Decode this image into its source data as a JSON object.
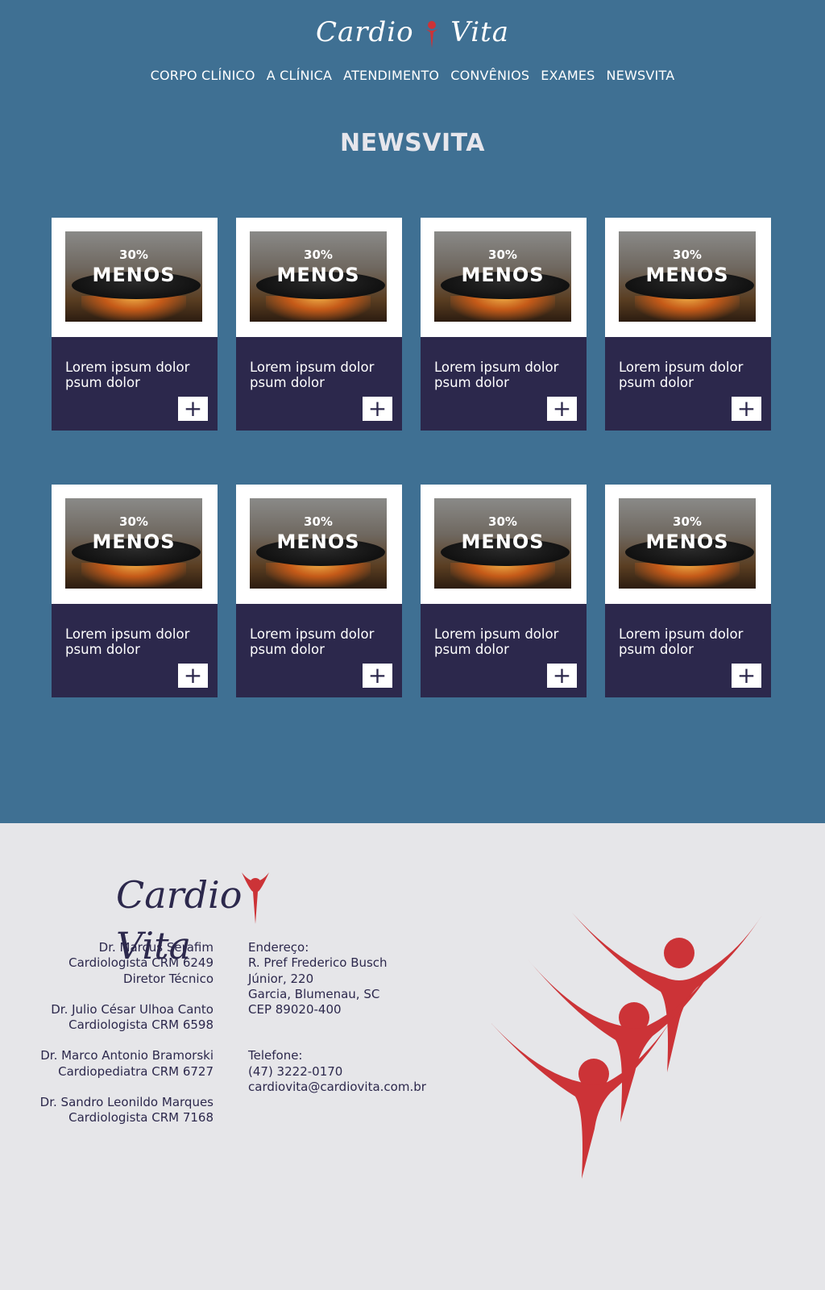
{
  "header": {
    "logo_text_left": "Cardio",
    "logo_text_right": "Vita",
    "nav": [
      "CORPO CLÍNICO",
      "A CLÍNICA",
      "ATENDIMENTO",
      "CONVÊNIOS",
      "EXAMES",
      "NEWSVITA"
    ]
  },
  "page_title": "NEWSVITA",
  "cards": [
    {
      "badge_pct": "30%",
      "badge_word": "MENOS",
      "text": "Lorem ipsum dolor psum dolor",
      "more_label": "+"
    },
    {
      "badge_pct": "30%",
      "badge_word": "MENOS",
      "text": "Lorem ipsum dolor psum dolor",
      "more_label": "+"
    },
    {
      "badge_pct": "30%",
      "badge_word": "MENOS",
      "text": "Lorem ipsum dolor psum dolor",
      "more_label": "+"
    },
    {
      "badge_pct": "30%",
      "badge_word": "MENOS",
      "text": "Lorem ipsum dolor psum dolor",
      "more_label": "+"
    },
    {
      "badge_pct": "30%",
      "badge_word": "MENOS",
      "text": "Lorem ipsum dolor psum dolor",
      "more_label": "+"
    },
    {
      "badge_pct": "30%",
      "badge_word": "MENOS",
      "text": "Lorem ipsum dolor psum dolor",
      "more_label": "+"
    },
    {
      "badge_pct": "30%",
      "badge_word": "MENOS",
      "text": "Lorem ipsum dolor psum dolor",
      "more_label": "+"
    },
    {
      "badge_pct": "30%",
      "badge_word": "MENOS",
      "text": "Lorem ipsum dolor psum dolor",
      "more_label": "+"
    }
  ],
  "footer": {
    "logo_text_left": "Cardio",
    "logo_text_right": "Vita",
    "doctors": [
      {
        "name": "Dr. Marcus Serafim",
        "specialty": "Cardiologista CRM 6249",
        "role": "Diretor Técnico"
      },
      {
        "name": "Dr. Julio César Ulhoa Canto",
        "specialty": "Cardiologista CRM 6598"
      },
      {
        "name": "Dr. Marco Antonio Bramorski",
        "specialty": "Cardiopediatra CRM 6727"
      },
      {
        "name": "Dr. Sandro Leonildo Marques",
        "specialty": "Cardiologista CRM 7168"
      }
    ],
    "address_label": "Endereço:",
    "address_lines": [
      "R. Pref Frederico Busch",
      "Júnior, 220",
      "Garcia, Blumenau, SC",
      "CEP 89020-400"
    ],
    "phone_label": "Telefone:",
    "phone": "(47) 3222-0170",
    "email": "cardiovita@cardiovita.com.br"
  },
  "colors": {
    "header_bg": "#3f7093",
    "card_dark": "#2c284c",
    "footer_bg": "#e6e6e9",
    "brand_red": "#cc3337"
  }
}
